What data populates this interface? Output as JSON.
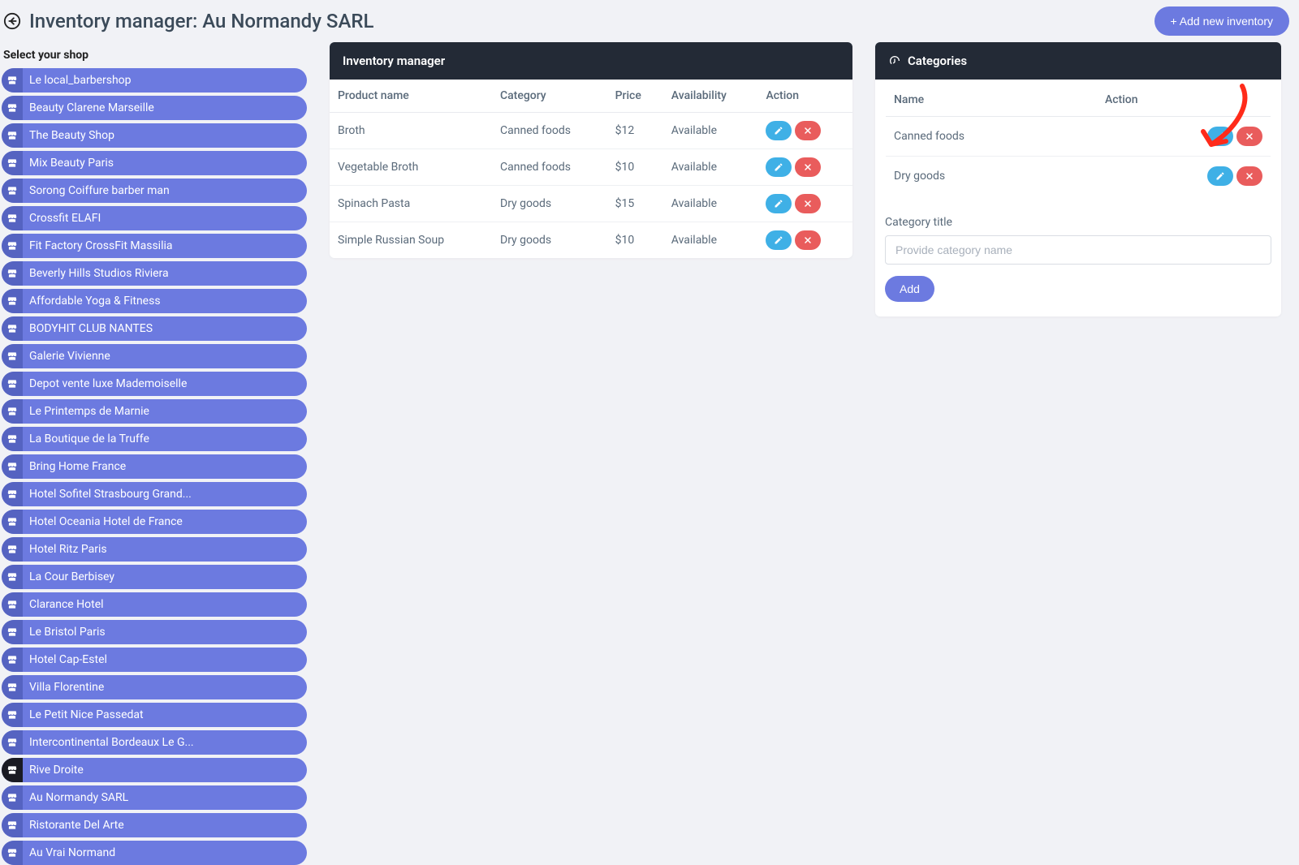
{
  "header": {
    "title": "Inventory manager: Au Normandy SARL",
    "add_button": "+ Add new inventory"
  },
  "sidebar": {
    "label": "Select your shop",
    "active_index": 25,
    "shops": [
      "Le local_barbershop",
      "Beauty Clarene Marseille",
      "The Beauty Shop",
      "Mix Beauty Paris",
      "Sorong Coiffure barber man",
      "Crossfit ELAFI",
      "Fit Factory CrossFit Massilia",
      "Beverly Hills Studios Riviera",
      "Affordable Yoga & Fitness",
      "BODYHIT CLUB NANTES",
      "Galerie Vivienne",
      "Depot vente luxe Mademoiselle",
      "Le Printemps de Marnie",
      "La Boutique de la Truffe",
      "Bring Home France",
      "Hotel Sofitel Strasbourg Grand...",
      "Hotel Oceania Hotel de France",
      "Hotel Ritz Paris",
      "La Cour Berbisey",
      "Clarance Hotel",
      "Le Bristol Paris",
      "Hotel Cap-Estel",
      "Villa Florentine",
      "Le Petit Nice Passedat",
      "Intercontinental Bordeaux Le G...",
      "Rive Droite",
      "Au Normandy SARL",
      "Ristorante Del Arte",
      "Au Vrai Normand"
    ]
  },
  "inventory": {
    "panel_title": "Inventory manager",
    "columns": {
      "name": "Product name",
      "category": "Category",
      "price": "Price",
      "availability": "Availability",
      "action": "Action"
    },
    "rows": [
      {
        "name": "Broth",
        "category": "Canned foods",
        "price": "$12",
        "availability": "Available"
      },
      {
        "name": "Vegetable Broth",
        "category": "Canned foods",
        "price": "$10",
        "availability": "Available"
      },
      {
        "name": "Spinach Pasta",
        "category": "Dry goods",
        "price": "$15",
        "availability": "Available"
      },
      {
        "name": "Simple Russian Soup",
        "category": "Dry goods",
        "price": "$10",
        "availability": "Available"
      }
    ]
  },
  "categories": {
    "panel_title": "Categories",
    "columns": {
      "name": "Name",
      "action": "Action"
    },
    "rows": [
      {
        "name": "Canned foods"
      },
      {
        "name": "Dry goods"
      }
    ],
    "form": {
      "label": "Category title",
      "placeholder": "Provide category name",
      "submit": "Add"
    }
  }
}
